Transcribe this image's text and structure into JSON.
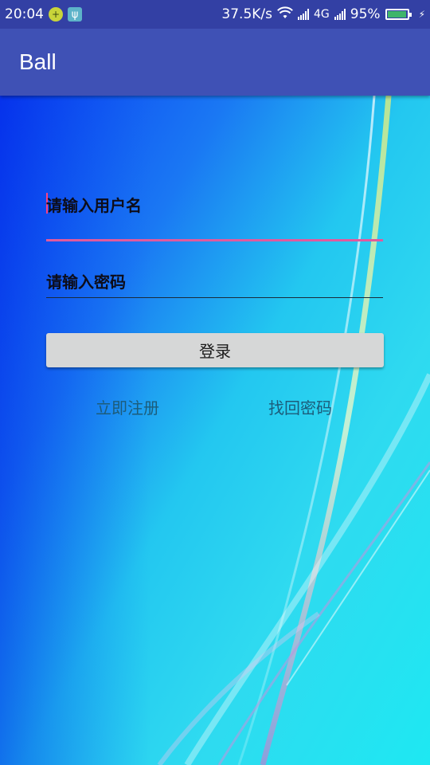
{
  "status_bar": {
    "time": "20:04",
    "speed": "37.5K/s",
    "network": "4G",
    "battery_percent": "95%",
    "battery_level": 0.95,
    "icons": [
      "notification-app-icon",
      "usb-icon",
      "wifi-icon",
      "signal-icon",
      "signal-icon",
      "battery-icon",
      "charging-icon"
    ]
  },
  "app_bar": {
    "title": "Ball"
  },
  "form": {
    "username_placeholder": "请输入用户名",
    "password_placeholder": "请输入密码",
    "login_label": "登录",
    "register_label": "立即注册",
    "recover_label": "找回密码"
  },
  "colors": {
    "status_bar": "#3340a4",
    "app_bar": "#3f51b5",
    "accent": "#ff4081",
    "button": "#d6d7d7"
  }
}
